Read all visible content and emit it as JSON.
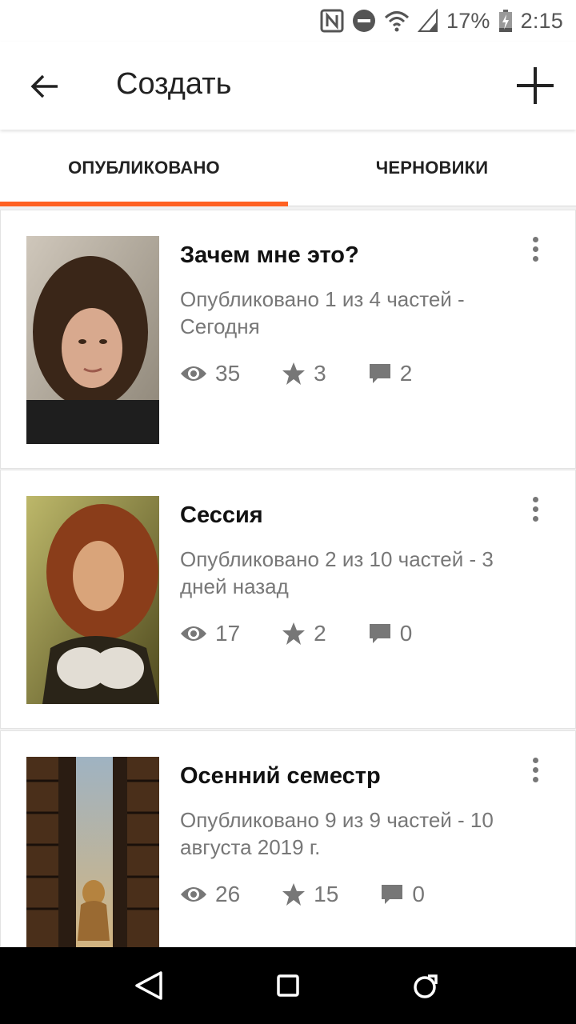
{
  "status_bar": {
    "battery": "17%",
    "time": "2:15",
    "icons": [
      "nfc-icon",
      "dnd-icon",
      "wifi-icon",
      "signal-icon",
      "battery-icon"
    ]
  },
  "app_bar": {
    "title": "Создать",
    "back_icon": "arrow-back-icon",
    "add_icon": "plus-icon"
  },
  "tabs": [
    {
      "label": "ОПУБЛИКОВАНО",
      "active": true
    },
    {
      "label": "ЧЕРНОВИКИ",
      "active": false
    }
  ],
  "colors": {
    "accent": "#ff6122",
    "text_secondary": "#777777",
    "nav_bar": "#000000"
  },
  "stories": [
    {
      "title": "Зачем мне это?",
      "meta": "Опубликовано 1 из 4 частей - Сегодня",
      "views": "35",
      "votes": "3",
      "comments": "2"
    },
    {
      "title": "Сессия",
      "meta": "Опубликовано 2 из 10 частей - 3 дней назад",
      "views": "17",
      "votes": "2",
      "comments": "0"
    },
    {
      "title": "Осенний семестр",
      "meta": "Опубликовано 9 из 9 частей - 10 августа 2019 г.",
      "views": "26",
      "votes": "15",
      "comments": "0"
    }
  ],
  "nav_bar": {
    "icons": [
      "nav-back-icon",
      "nav-home-icon",
      "nav-recents-icon"
    ]
  }
}
